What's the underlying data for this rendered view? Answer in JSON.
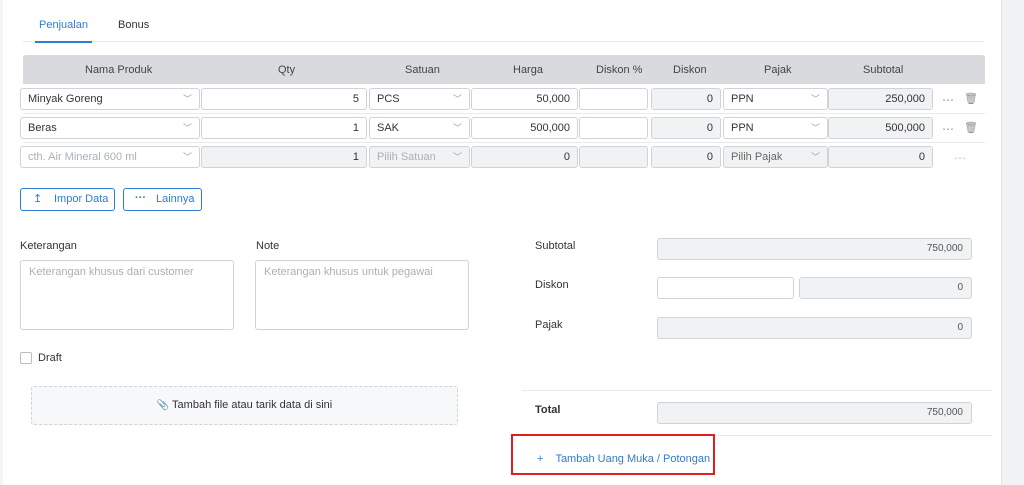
{
  "tabs": [
    {
      "label": "Penjualan"
    },
    {
      "label": "Bonus"
    }
  ],
  "columns": {
    "product": "Nama Produk",
    "qty": "Qty",
    "unit": "Satuan",
    "price": "Harga",
    "disc_pct": "Diskon %",
    "disc": "Diskon",
    "tax": "Pajak",
    "subtotal": "Subtotal"
  },
  "rows": [
    {
      "product": "Minyak Goreng",
      "qty": "5",
      "unit": "PCS",
      "price": "50,000",
      "disc_pct": "",
      "disc": "0",
      "tax": "PPN",
      "subtotal": "250,000"
    },
    {
      "product": "Beras",
      "qty": "1",
      "unit": "SAK",
      "price": "500,000",
      "disc_pct": "",
      "disc": "0",
      "tax": "PPN",
      "subtotal": "500,000"
    }
  ],
  "new_row": {
    "product_placeholder": "cth. Air Mineral 600 ml",
    "qty": "1",
    "unit_placeholder": "Pilih Satuan",
    "price": "0",
    "disc": "0",
    "tax_placeholder": "Pilih Pajak",
    "subtotal": "0"
  },
  "icons": {
    "more": "⋯",
    "trash": "🗑",
    "chevron": "﹀",
    "upload": "↥",
    "dots": "···",
    "paperclip": "📎",
    "plus": "+"
  },
  "buttons": {
    "import": "Impor Data",
    "more": "Lainnya"
  },
  "notes": {
    "keterangan_label": "Keterangan",
    "keterangan_placeholder": "Keterangan khusus dari customer",
    "note_label": "Note",
    "note_placeholder": "Keterangan khusus untuk pegawai",
    "draft_label": "Draft"
  },
  "attach": {
    "label": "Tambah file atau tarik data di sini"
  },
  "summary": {
    "subtotal_label": "Subtotal",
    "subtotal": "750,000",
    "diskon_label": "Diskon",
    "diskon": "0",
    "pajak_label": "Pajak",
    "pajak": "0",
    "total_label": "Total",
    "total": "750,000"
  },
  "add_down_payment": "Tambah Uang Muka / Potongan",
  "colors": {
    "accent": "#2f7cd4",
    "highlight": "#e02020"
  }
}
